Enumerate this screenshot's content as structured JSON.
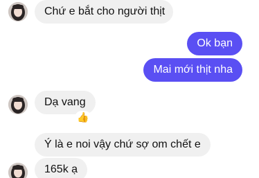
{
  "messages": [
    {
      "text": "Chứ e bắt cho người thịt"
    },
    {
      "text": "Ok bạn"
    },
    {
      "text": "Mai mới thịt nha"
    },
    {
      "text": "Dạ vang"
    },
    {
      "text": "Ý  là e noi vậy chứ sợ om chết e"
    },
    {
      "text": "165k ạ"
    }
  ],
  "reaction": {
    "emoji": "👍",
    "icon": "thumbs-up-icon"
  },
  "colors": {
    "outgoing_bubble": "#5a4ff3",
    "incoming_bubble": "#f0f0f0"
  }
}
